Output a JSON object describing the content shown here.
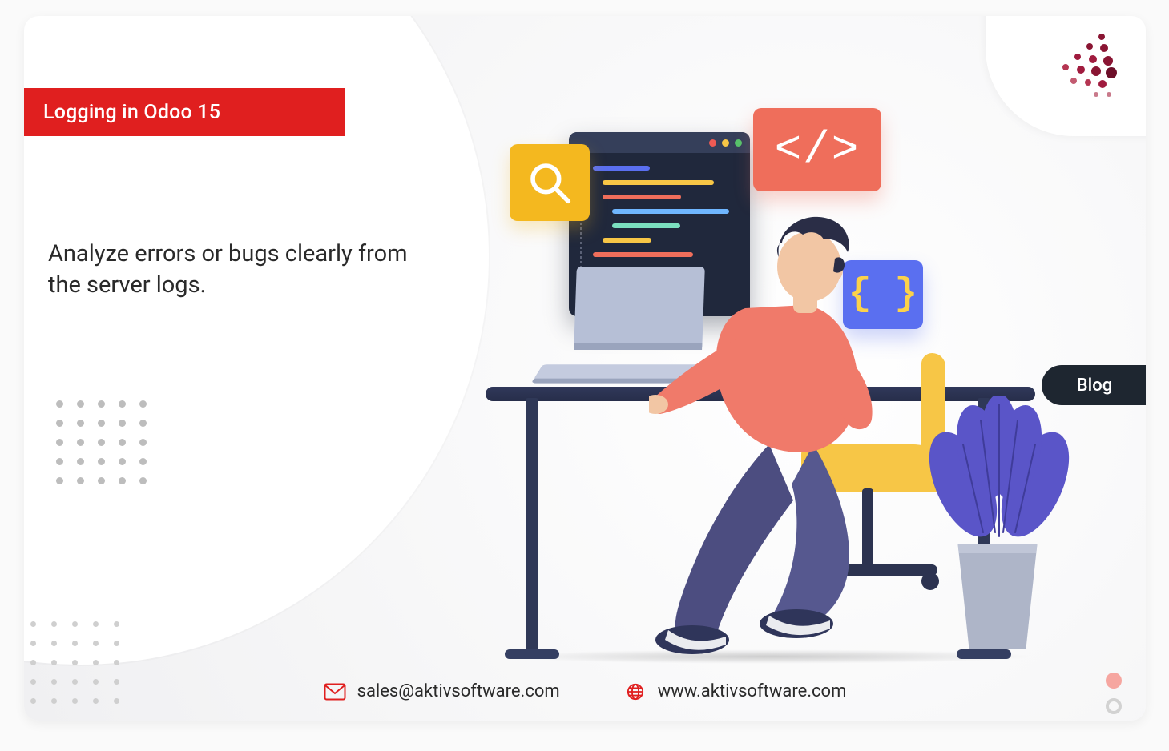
{
  "banner": {
    "title": "Logging in Odoo 15"
  },
  "hero": {
    "subtitle": "Analyze errors or bugs clearly from the server logs."
  },
  "badge": {
    "side_label": "Blog",
    "code_symbol": "</>",
    "braces_symbol": "{ }"
  },
  "contact": {
    "email": "sales@aktivsoftware.com",
    "website": "www.aktivsoftware.com"
  },
  "colors": {
    "accent_red": "#e01f1f",
    "badge_yellow": "#f4b81f",
    "badge_coral": "#ef6e5b",
    "badge_blue": "#5a6ff0"
  }
}
